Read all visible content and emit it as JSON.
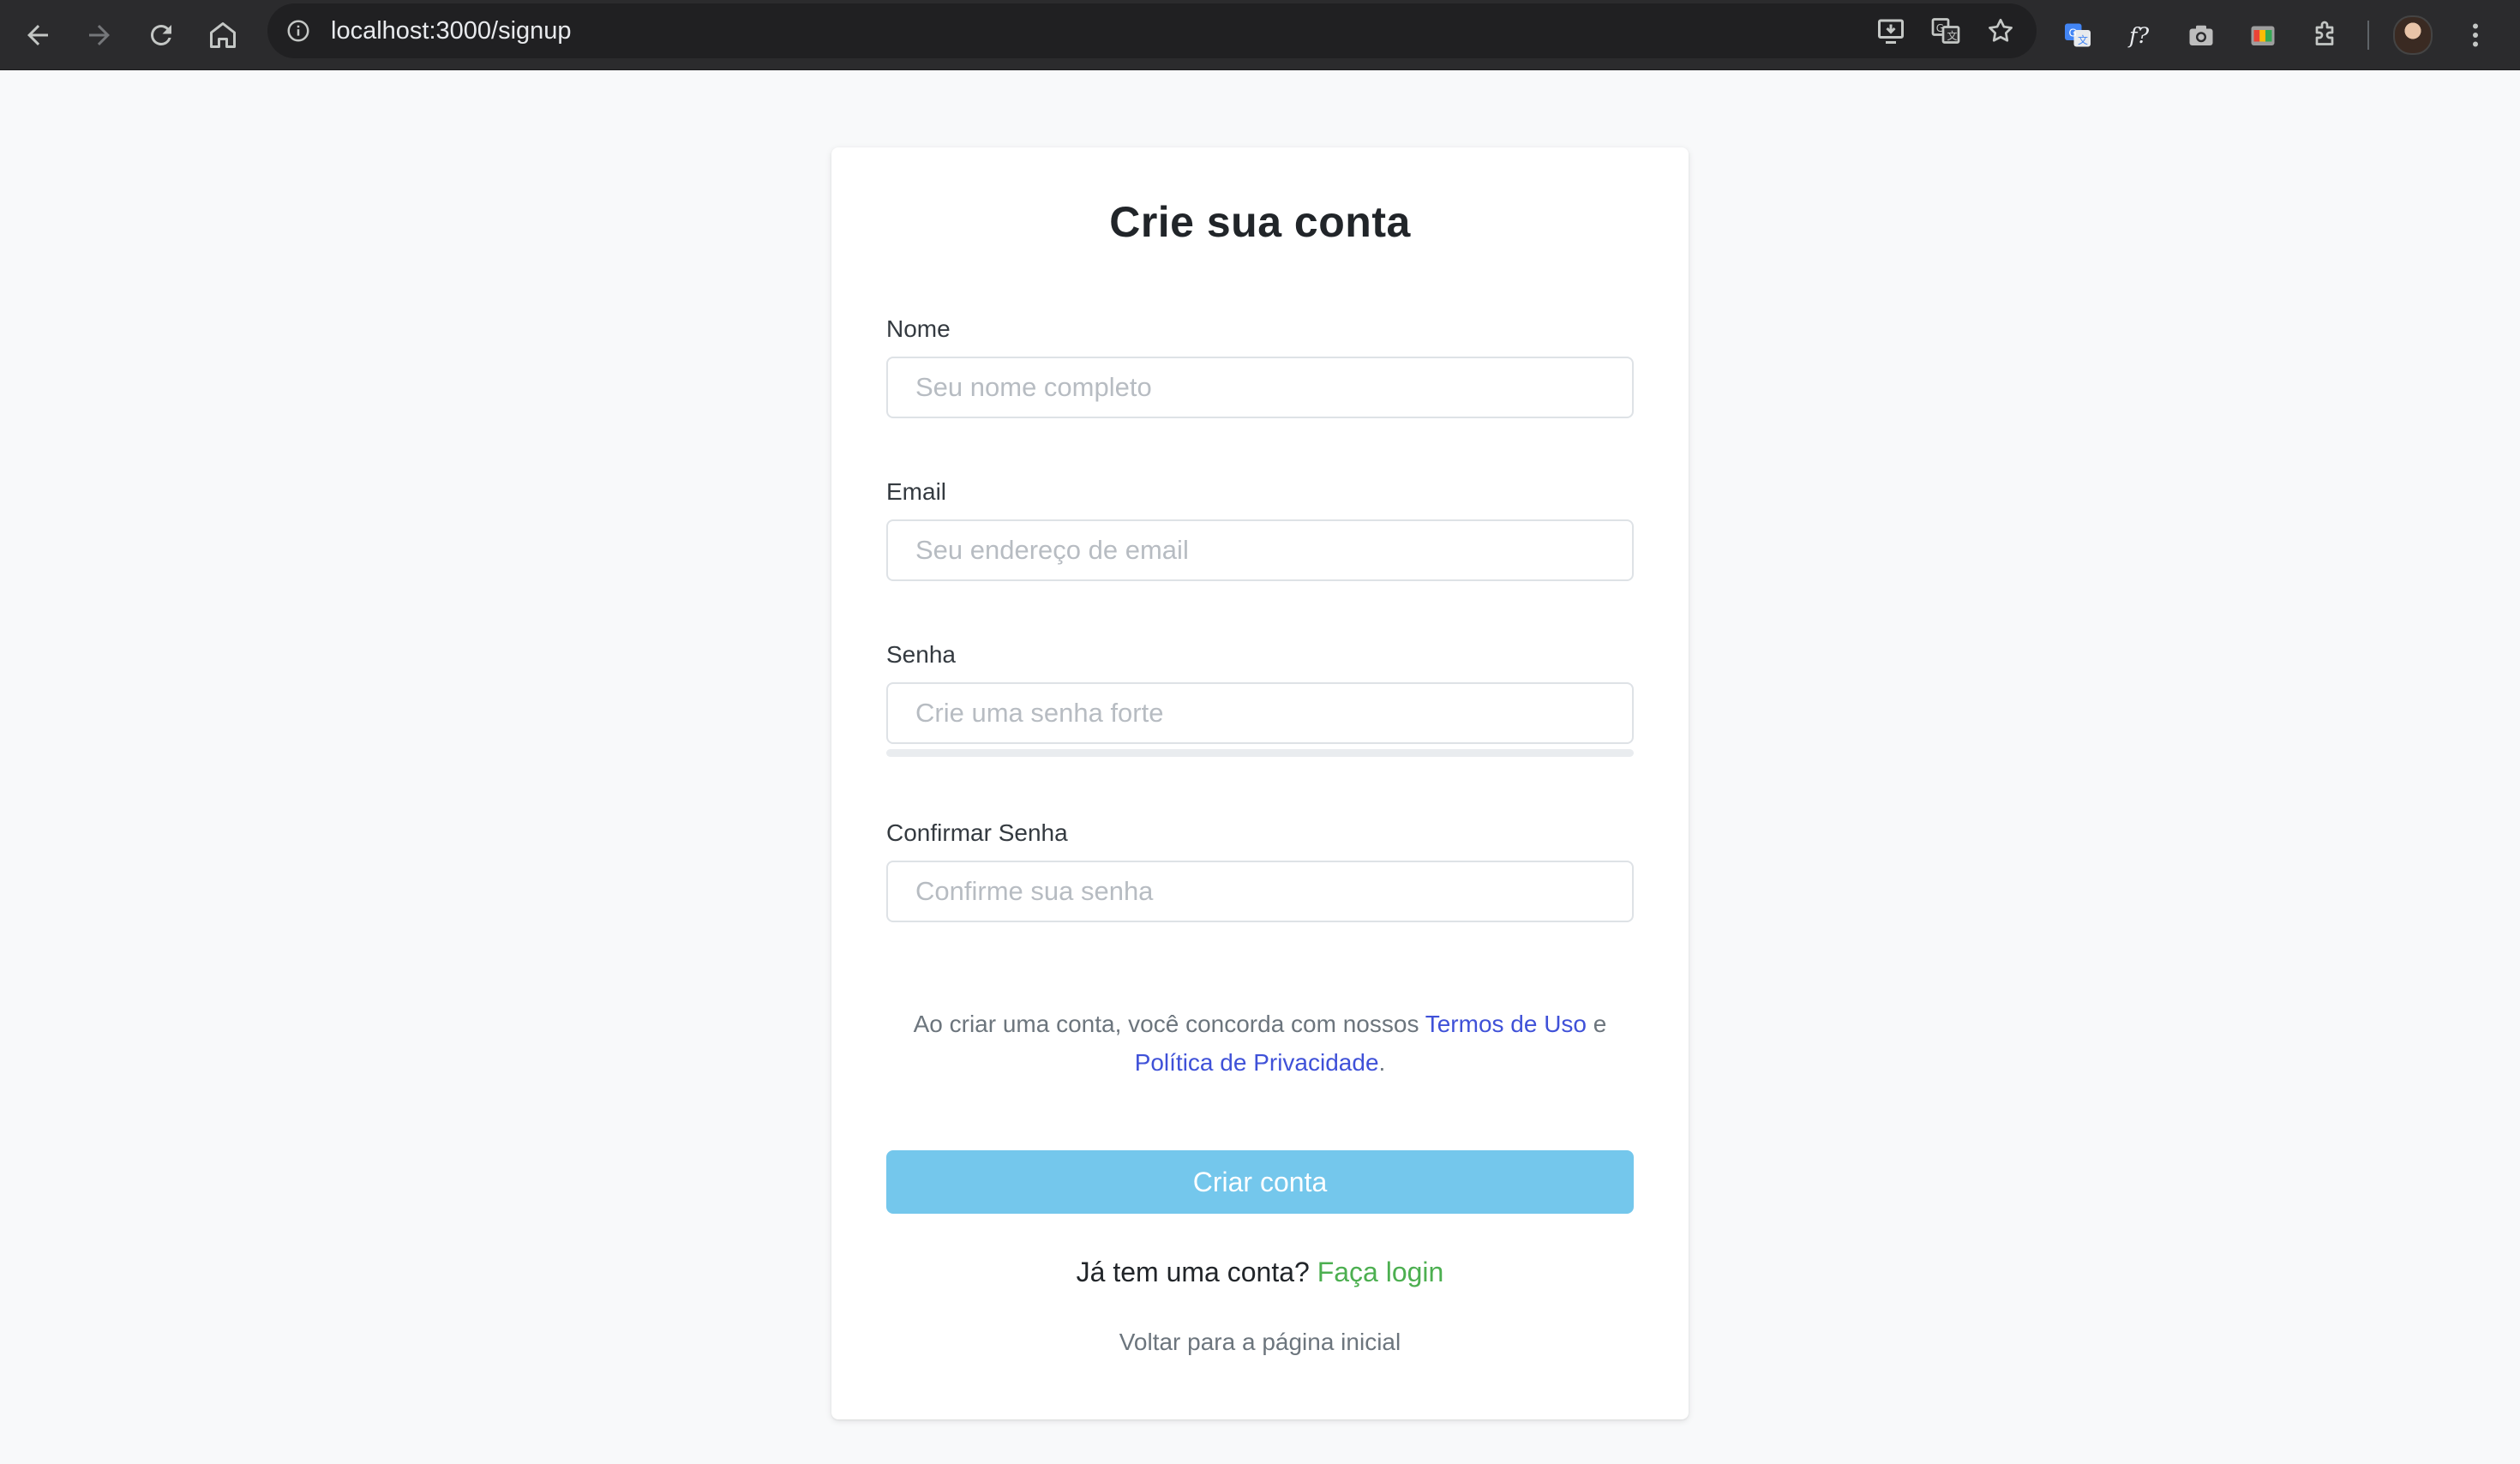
{
  "browser": {
    "url": "localhost:3000/signup",
    "icons": {
      "back": "arrow-left-icon",
      "forward": "arrow-right-icon",
      "reload": "reload-icon",
      "home": "home-icon",
      "site_info": "info-icon",
      "install": "install-app-icon",
      "translate": "translate-icon",
      "bookmark": "star-icon",
      "extensions": [
        "google-translate-extension-icon",
        "font-finder-extension-icon",
        "camera-extension-icon",
        "color-extension-icon",
        "puzzle-icon"
      ],
      "menu": "kebab-menu-icon"
    }
  },
  "signup": {
    "title": "Crie sua conta",
    "fields": {
      "name": {
        "label": "Nome",
        "placeholder": "Seu nome completo"
      },
      "email": {
        "label": "Email",
        "placeholder": "Seu endereço de email"
      },
      "password": {
        "label": "Senha",
        "placeholder": "Crie uma senha forte",
        "strength_percent": 0
      },
      "confirm": {
        "label": "Confirmar Senha",
        "placeholder": "Confirme sua senha"
      }
    },
    "terms": {
      "prefix": "Ao criar uma conta, você concorda com nossos ",
      "terms_link": "Termos de Uso",
      "connector": " e ",
      "privacy_link": "Política de Privacidade",
      "suffix": "."
    },
    "submit_label": "Criar conta",
    "login_prompt": "Já tem uma conta? ",
    "login_link": "Faça login",
    "home_link": "Voltar para a página inicial"
  },
  "colors": {
    "page_bg": "#f8f9fa",
    "primary_button": "#74c7ec",
    "link_blue": "#3f51d8",
    "link_green": "#4caf50",
    "chrome_bg": "#2b2b2d"
  }
}
